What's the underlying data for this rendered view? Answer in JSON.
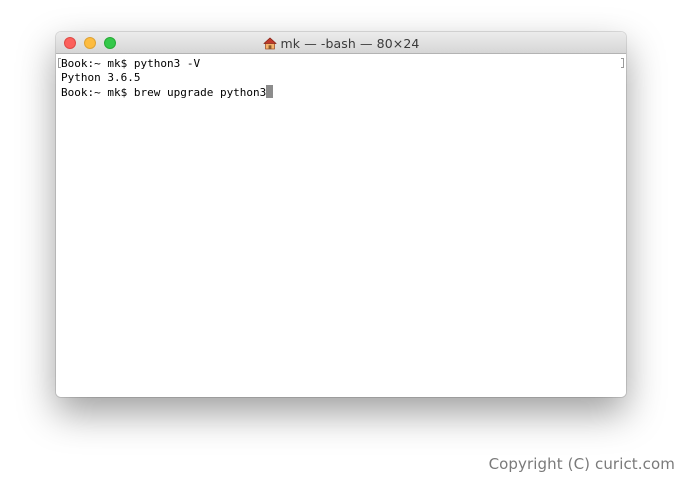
{
  "window": {
    "title": "mk — -bash — 80×24",
    "title_icon": "home-icon",
    "buttons": {
      "close_color": "#fc605c",
      "minimize_color": "#fdbc40",
      "zoom_color": "#34c84a"
    }
  },
  "terminal": {
    "lines": [
      "Book:~ mk$ python3 -V",
      "Python 3.6.5",
      "Book:~ mk$ brew upgrade python3"
    ],
    "cursor_color": "#8c8c8c"
  },
  "watermark": {
    "text": "Copyright (C) curict.com"
  }
}
